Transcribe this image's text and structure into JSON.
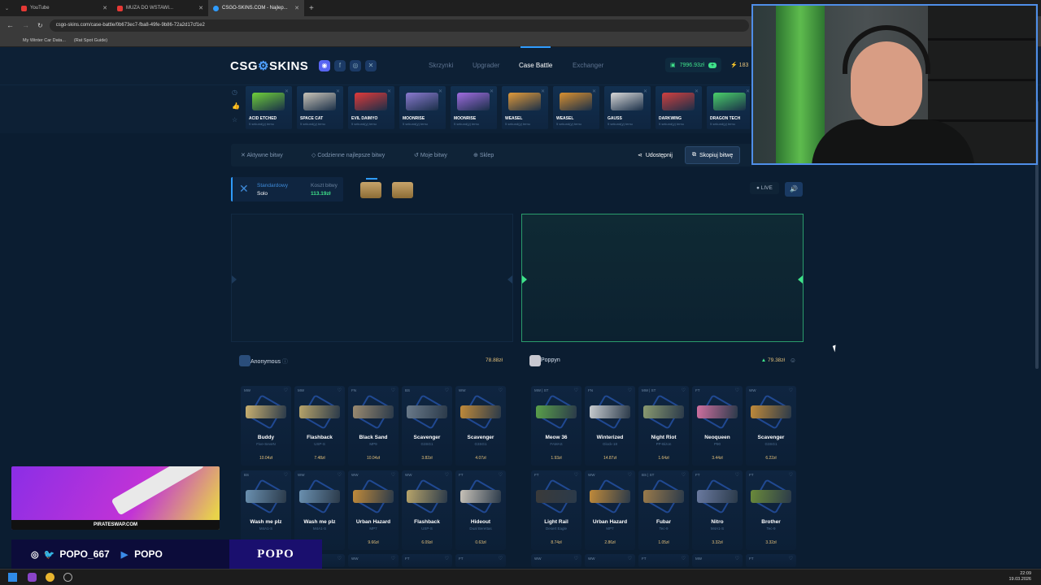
{
  "browser": {
    "tabs": [
      {
        "label": "YouTube",
        "color": "#e53935"
      },
      {
        "label": "MUZA DO WSTAWI...",
        "color": "#e53935"
      },
      {
        "label": "CSGO-SKINS.COM - Najlep...",
        "color": "#2f9cff"
      }
    ],
    "url": "csgo-skins.com/case-battle/0b673ec7-fba8-49fe-9b86-72a2d17cf1e2",
    "bookmarks": [
      "My Winter Car Data...",
      "(Rat Spot Guide)"
    ]
  },
  "site": {
    "logo_left": "CSG",
    "logo_right": "SKINS",
    "nav": [
      "Skrzynki",
      "Upgrader",
      "Case Battle",
      "Exchanger"
    ],
    "balance": "7996.93zł",
    "balance_extra": "183",
    "cases": [
      {
        "name": "ACID ETCHED",
        "color": "#6fcf3a"
      },
      {
        "name": "SPACE CAT",
        "color": "#c9c4b8"
      },
      {
        "name": "EVIL DAIMYO",
        "color": "#e03a3a"
      },
      {
        "name": "MOONRISE",
        "color": "#8a7ad0"
      },
      {
        "name": "MOONRISE",
        "color": "#a06ce0"
      },
      {
        "name": "WEASEL",
        "color": "#e09a3a"
      },
      {
        "name": "WEASEL",
        "color": "#d89030"
      },
      {
        "name": "GAUSS",
        "color": "#d8d8d8"
      },
      {
        "name": "DARKWING",
        "color": "#d04040"
      },
      {
        "name": "DRAGON TECH",
        "color": "#4ad06a"
      }
    ],
    "case_sub": "5 sekund(y) temu",
    "subnav": [
      "Aktywne bitwy",
      "Codzienne najlepsze bitwy",
      "Moje bitwy",
      "Sklep"
    ],
    "share": "Udostępnij",
    "copy": "Skopiuj bitwę",
    "mode_title": "Standardowy",
    "mode_value": "Solo",
    "cost_title": "Koszt bitwy",
    "cost_value": "113.19zł",
    "live": "LIVE",
    "players": [
      {
        "name": "Anonymous",
        "total": "78.88zł",
        "items": [
          {
            "cond": "MW",
            "name": "Buddy",
            "sub": "Five-SeveN",
            "price": "10.04zł",
            "color": "#c9b070"
          },
          {
            "cond": "MW",
            "name": "Flashback",
            "sub": "USP-S",
            "price": "7.48zł",
            "color": "#b8a46a"
          },
          {
            "cond": "FN",
            "name": "Black Sand",
            "sub": "MP9",
            "price": "10.04zł",
            "color": "#9a8a70"
          },
          {
            "cond": "BS",
            "name": "Scavenger",
            "sub": "G3SG1",
            "price": "3.82zł",
            "color": "#6a7a8a"
          },
          {
            "cond": "WW",
            "name": "Scavenger",
            "sub": "G3SG1",
            "price": "4.07zł",
            "color": "#c08a3a"
          },
          {
            "cond": "BS",
            "name": "Wash me plz",
            "sub": "M4A1-S",
            "price": "",
            "color": "#6a90b0"
          },
          {
            "cond": "WW",
            "name": "Wash me plz",
            "sub": "M4A1-S",
            "price": "",
            "color": "#6a90b0"
          },
          {
            "cond": "WW",
            "name": "Urban Hazard",
            "sub": "MP7",
            "price": "9.66zł",
            "color": "#c08a3a"
          },
          {
            "cond": "WW",
            "name": "Flashback",
            "sub": "USP-S",
            "price": "6.09zł",
            "color": "#b8a46a"
          },
          {
            "cond": "FT",
            "name": "Hideout",
            "sub": "Dual Berettas",
            "price": "0.63zł",
            "color": "#c8c2b8"
          }
        ]
      },
      {
        "name": "Poppyn",
        "total": "79.38zł",
        "items": [
          {
            "cond": "MW | ST",
            "name": "Meow 36",
            "sub": "FAMAS",
            "price": "1.93zł",
            "color": "#5aa04a"
          },
          {
            "cond": "FN",
            "name": "Winterized",
            "sub": "Glock-18",
            "price": "14.87zł",
            "color": "#c8ccd0"
          },
          {
            "cond": "MW | ST",
            "name": "Night Riot",
            "sub": "PP-Bizon",
            "price": "1.64zł",
            "color": "#8a9a70"
          },
          {
            "cond": "FT",
            "name": "Neoqueen",
            "sub": "P90",
            "price": "3.44zł",
            "color": "#d070a0"
          },
          {
            "cond": "WW",
            "name": "Scavenger",
            "sub": "G3SG1",
            "price": "6.22zł",
            "color": "#c08a3a"
          },
          {
            "cond": "FT",
            "name": "Light Rail",
            "sub": "Desert Eagle",
            "price": "8.74zł",
            "color": "#3a3a3a"
          },
          {
            "cond": "WW",
            "name": "Urban Hazard",
            "sub": "MP7",
            "price": "2.86zł",
            "color": "#c08a3a"
          },
          {
            "cond": "BS | ST",
            "name": "Fubar",
            "sub": "Tec-9",
            "price": "1.05zł",
            "color": "#9a7a4a"
          },
          {
            "cond": "FT",
            "name": "Nitro",
            "sub": "M4A1-S",
            "price": "3.32zł",
            "color": "#6a7aa0"
          },
          {
            "cond": "FT",
            "name": "Brother",
            "sub": "Tec-9",
            "price": "3.32zł",
            "color": "#6a8a3a"
          }
        ]
      }
    ],
    "row3_conds_left": [
      "BS",
      "WW",
      "WW",
      "FT",
      "FT"
    ],
    "row3_conds_right": [
      "WW",
      "WW",
      "FT",
      "MW",
      "FT"
    ]
  },
  "overlay": {
    "ad_label": "PIRATESWAP.COM",
    "handle": "POPO_667",
    "yt": "POPO",
    "banner": "POPO"
  },
  "taskbar": {
    "time": "22:09",
    "date": "19.03.2026"
  }
}
